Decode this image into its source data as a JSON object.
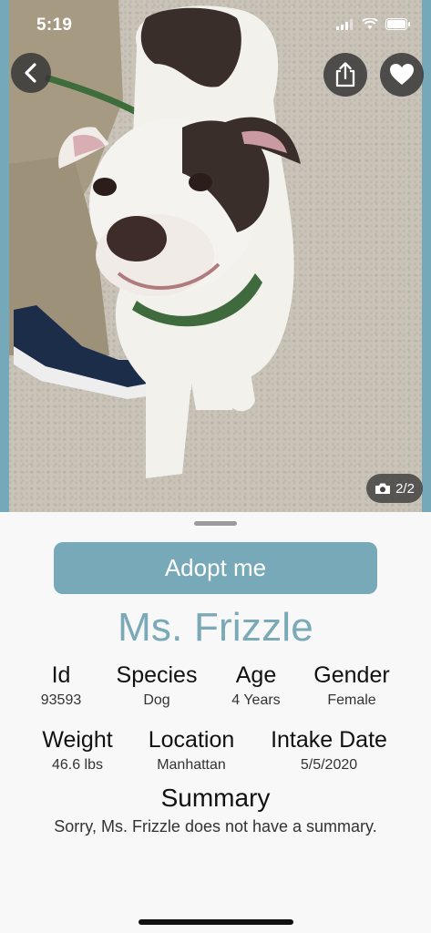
{
  "status_bar": {
    "time": "5:19"
  },
  "photo": {
    "counter": "2/2"
  },
  "adopt_button": "Adopt me",
  "pet": {
    "name": "Ms. Frizzle",
    "details_row1": [
      {
        "label": "Id",
        "value": "93593"
      },
      {
        "label": "Species",
        "value": "Dog"
      },
      {
        "label": "Age",
        "value": "4 Years"
      },
      {
        "label": "Gender",
        "value": "Female"
      }
    ],
    "details_row2": [
      {
        "label": "Weight",
        "value": "46.6 lbs"
      },
      {
        "label": "Location",
        "value": "Manhattan"
      },
      {
        "label": "Intake Date",
        "value": "5/5/2020"
      }
    ]
  },
  "summary": {
    "title": "Summary",
    "text": "Sorry, Ms. Frizzle does not have a summary."
  },
  "colors": {
    "accent": "#77a9b8",
    "photo_frame": "#75a9b9"
  }
}
